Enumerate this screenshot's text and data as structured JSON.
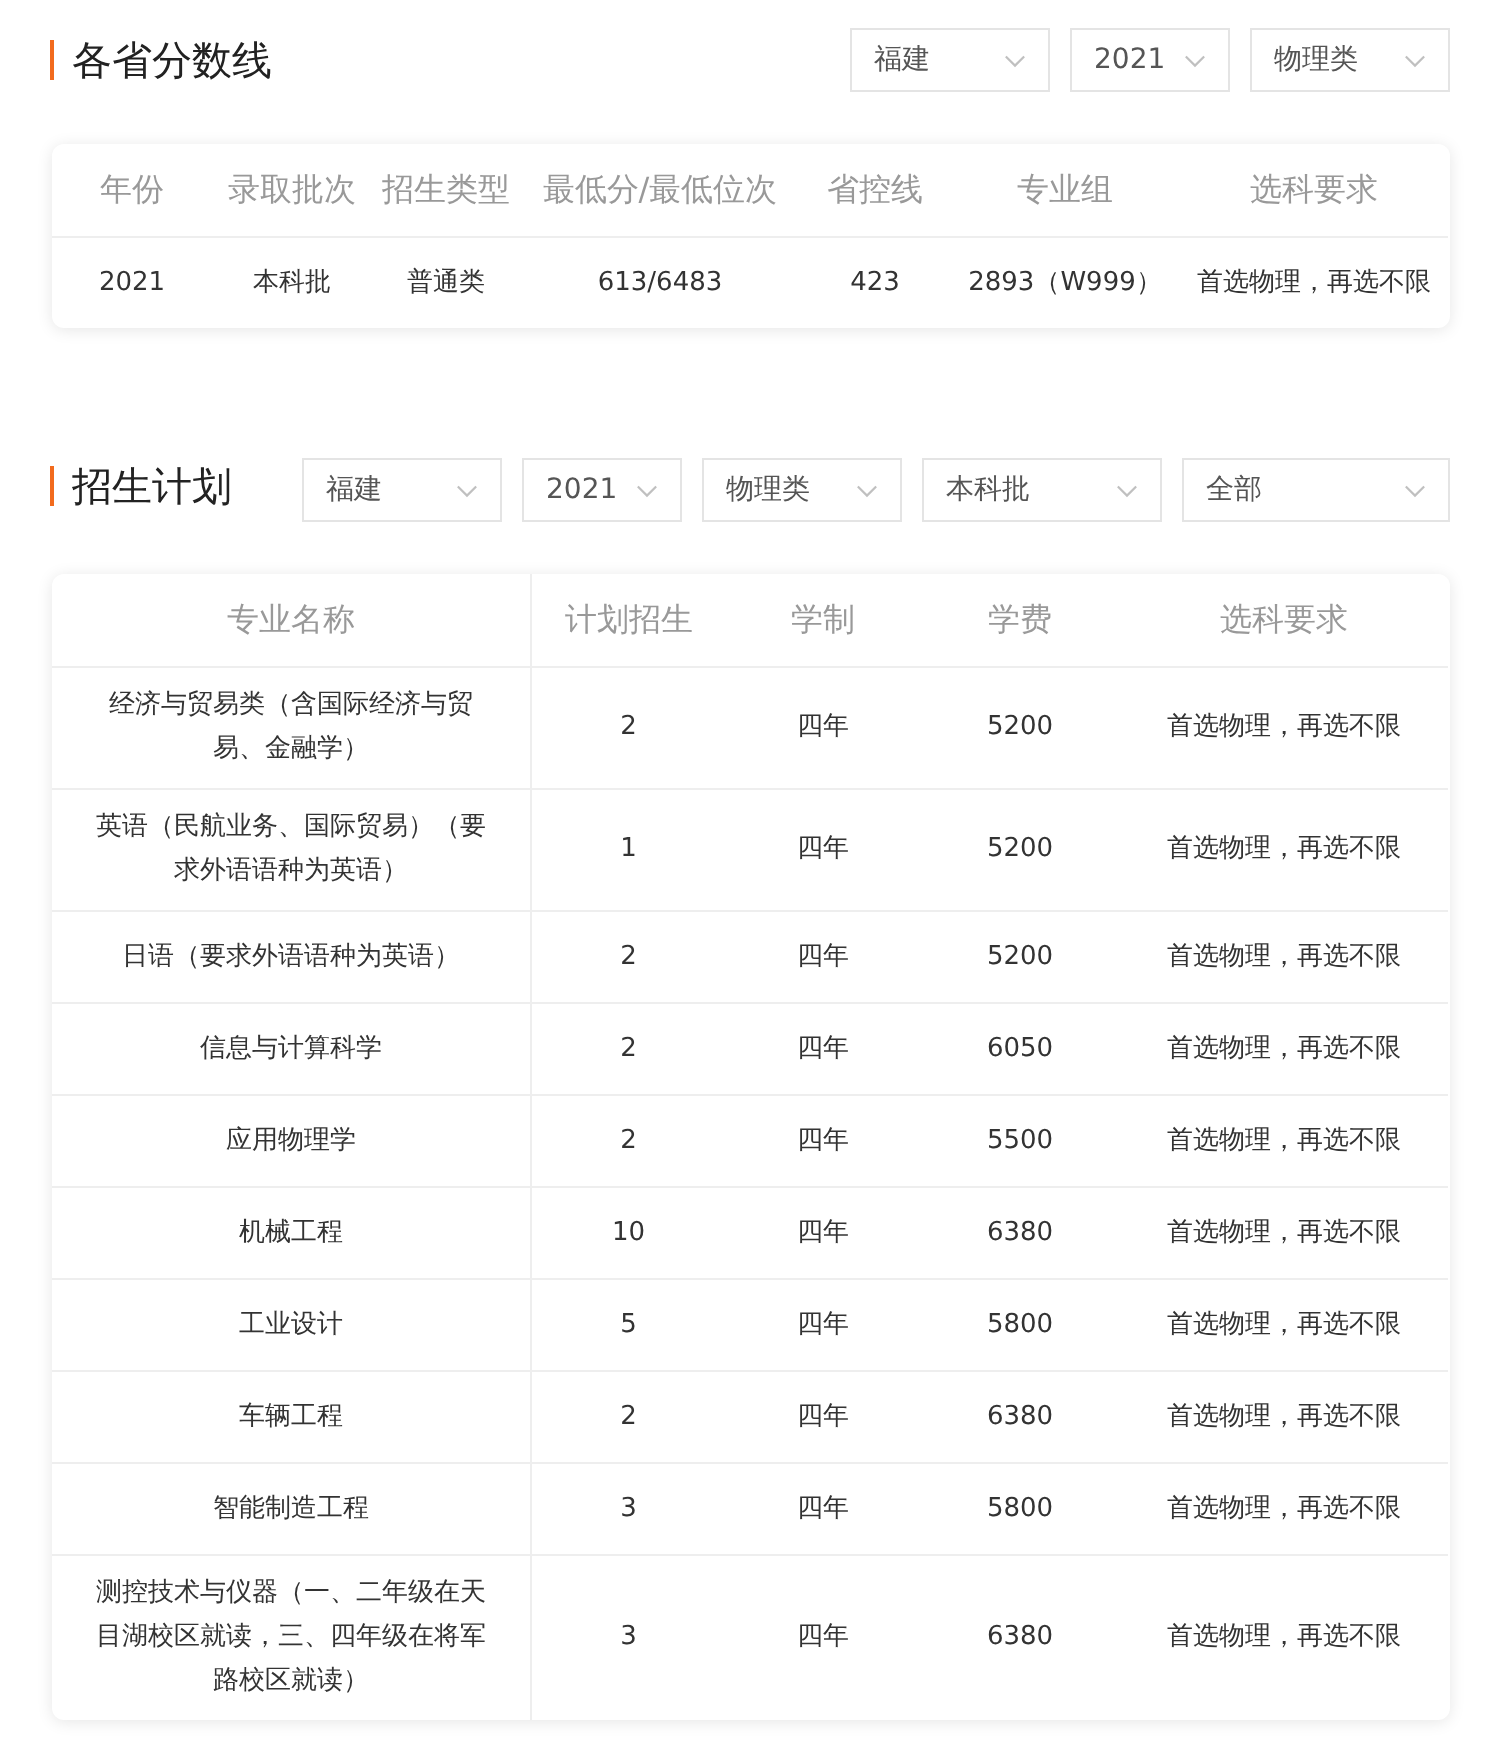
{
  "score_section": {
    "title": "各省分数线",
    "filters": [
      {
        "value": "福建"
      },
      {
        "value": "2021"
      },
      {
        "value": "物理类"
      }
    ],
    "table": {
      "columns": [
        "年份",
        "录取批次",
        "招生类型",
        "最低分/最低位次",
        "省控线",
        "专业组",
        "选科要求"
      ],
      "rows": [
        [
          "2021",
          "本科批",
          "普通类",
          "613/6483",
          "423",
          "2893（W999）",
          "首选物理，再选不限"
        ]
      ]
    }
  },
  "plan_section": {
    "title": "招生计划",
    "filters": [
      {
        "value": "福建"
      },
      {
        "value": "2021"
      },
      {
        "value": "物理类"
      },
      {
        "value": "本科批"
      },
      {
        "value": "全部"
      }
    ],
    "table": {
      "columns": [
        "专业名称",
        "计划招生",
        "学制",
        "学费",
        "选科要求"
      ],
      "rows": [
        [
          "经济与贸易类（含国际经济与贸易、金融学）",
          "2",
          "四年",
          "5200",
          "首选物理，再选不限"
        ],
        [
          "英语（民航业务、国际贸易）（要求外语语种为英语）",
          "1",
          "四年",
          "5200",
          "首选物理，再选不限"
        ],
        [
          "日语（要求外语语种为英语）",
          "2",
          "四年",
          "5200",
          "首选物理，再选不限"
        ],
        [
          "信息与计算科学",
          "2",
          "四年",
          "6050",
          "首选物理，再选不限"
        ],
        [
          "应用物理学",
          "2",
          "四年",
          "5500",
          "首选物理，再选不限"
        ],
        [
          "机械工程",
          "10",
          "四年",
          "6380",
          "首选物理，再选不限"
        ],
        [
          "工业设计",
          "5",
          "四年",
          "5800",
          "首选物理，再选不限"
        ],
        [
          "车辆工程",
          "2",
          "四年",
          "6380",
          "首选物理，再选不限"
        ],
        [
          "智能制造工程",
          "3",
          "四年",
          "5800",
          "首选物理，再选不限"
        ],
        [
          "测控技术与仪器（一、二年级在天目湖校区就读，三、四年级在将军路校区就读）",
          "3",
          "四年",
          "6380",
          "首选物理，再选不限"
        ]
      ]
    }
  }
}
